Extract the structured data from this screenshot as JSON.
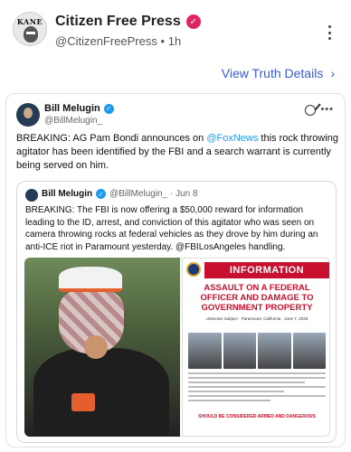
{
  "header": {
    "avatar_text": "KANE",
    "name": "Citizen Free Press",
    "verified_badge": "✓",
    "handle": "@CitizenFreePress",
    "separator": "•",
    "time": "1h"
  },
  "view_truth": {
    "label": "View Truth Details",
    "chevron": "›"
  },
  "card": {
    "author_name": "Bill Melugin",
    "verified_badge": "✓",
    "handle": "@BillMelugin_",
    "more": "•••",
    "text_before": "BREAKING: AG Pam Bondi announces on ",
    "mention": "@FoxNews",
    "text_after": " this rock throwing agitator has been identified by the FBI and a search warrant is currently being served on him."
  },
  "quote": {
    "author_name": "Bill Melugin",
    "verified_badge": "✓",
    "meta": "@BillMelugin_ · Jun 8",
    "text": "BREAKING: The FBI is now offering a $50,000 reward for information leading to the ID, arrest, and conviction of this agitator who was seen on camera throwing rocks at federal vehicles as they drove by him during an anti-ICE riot in Paramount yesterday. @FBILosAngeles handling.",
    "poster": {
      "title": "INFORMATION",
      "headline": "ASSAULT ON A FEDERAL OFFICER AND DAMAGE TO GOVERNMENT PROPERTY",
      "sub": "Unknown Subject · Paramount, California · June 7, 2025",
      "warn": "SHOULD BE CONSIDERED ARMED AND DANGEROUS"
    }
  },
  "colors": {
    "link": "#1d9bf0",
    "view_truth": "#3a5bd9",
    "poster_red": "#c8102e",
    "verified_red": "#e0245e"
  }
}
